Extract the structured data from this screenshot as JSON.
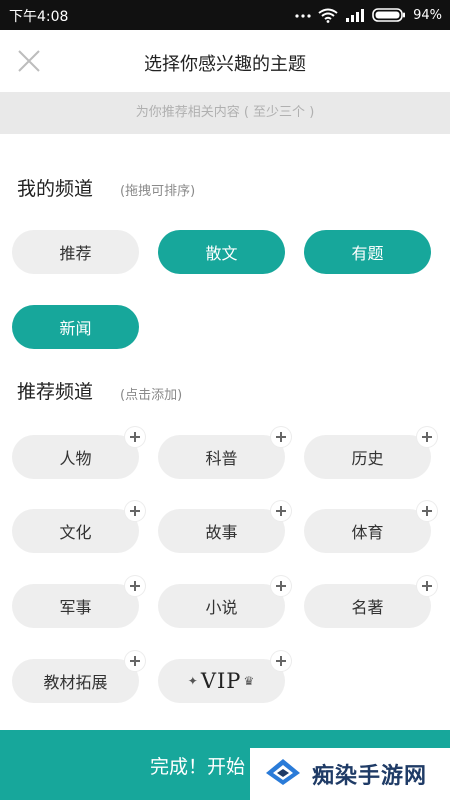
{
  "status_bar": {
    "time": "下午4:08",
    "battery": "94%",
    "icons": [
      "dots-icon",
      "wifi-icon",
      "signal-icon",
      "battery-icon"
    ]
  },
  "header": {
    "title": "选择你感兴趣的主题",
    "close_icon": "close-icon"
  },
  "subtitle": "为你推荐相关内容 ( 至少三个 )",
  "my_channels": {
    "title": "我的频道",
    "hint": "(拖拽可排序)",
    "items": [
      {
        "label": "推荐",
        "selected": false
      },
      {
        "label": "散文",
        "selected": true
      },
      {
        "label": "有题",
        "selected": true
      },
      {
        "label": "新闻",
        "selected": true
      }
    ]
  },
  "recommended_channels": {
    "title": "推荐频道",
    "hint": "(点击添加)",
    "items": [
      {
        "label": "人物"
      },
      {
        "label": "科普"
      },
      {
        "label": "历史"
      },
      {
        "label": "文化"
      },
      {
        "label": "故事"
      },
      {
        "label": "体育"
      },
      {
        "label": "军事"
      },
      {
        "label": "小说"
      },
      {
        "label": "名著"
      },
      {
        "label": "教材拓展"
      },
      {
        "label": "VIP",
        "style": "logo"
      }
    ]
  },
  "bottom_button": {
    "label": "完成！开始"
  },
  "watermark": {
    "text": "痴染手游网"
  },
  "colors": {
    "accent": "#17a79b",
    "chip_bg": "#eeeeee",
    "subtitle_bg": "#e9e9e9",
    "status_bar_bg": "#111111"
  }
}
